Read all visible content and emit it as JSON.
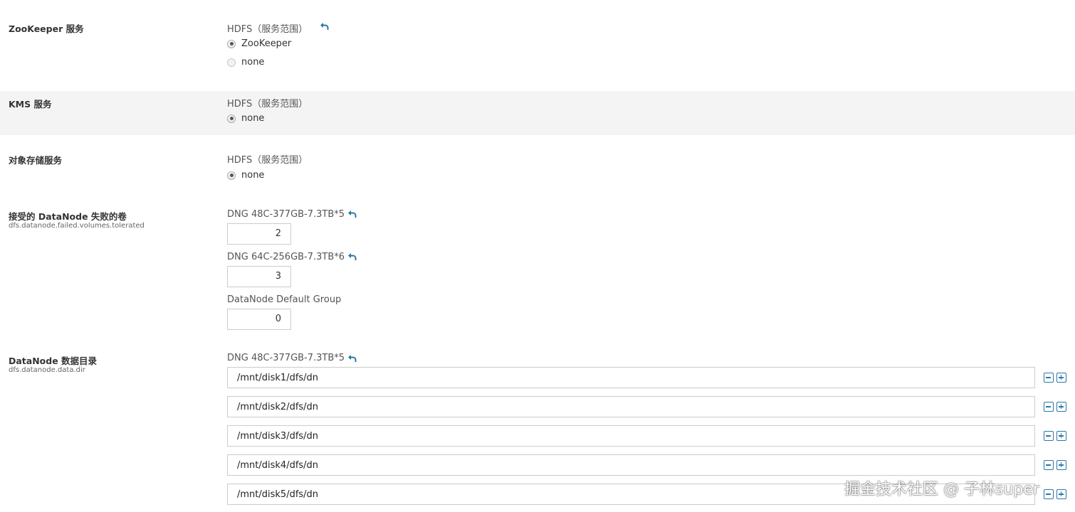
{
  "settings": [
    {
      "label": "ZooKeeper 服务",
      "group": "HDFS（服务范围）",
      "options": [
        "ZooKeeper",
        "none"
      ],
      "selected": "ZooKeeper"
    },
    {
      "label": "KMS 服务",
      "group": "HDFS（服务范围）",
      "options": [
        "none"
      ],
      "selected": "none"
    },
    {
      "label": "对象存储服务",
      "group": "HDFS（服务范围）",
      "options": [
        "none"
      ],
      "selected": "none"
    },
    {
      "label": "接受的 DataNode 失败的卷",
      "property": "dfs.datanode.failed.volumes.tolerated",
      "groups": [
        {
          "name": "DNG 48C-377GB-7.3TB*5",
          "value": "2"
        },
        {
          "name": "DNG 64C-256GB-7.3TB*6",
          "value": "3"
        },
        {
          "name": "DataNode Default Group",
          "value": "0"
        }
      ]
    },
    {
      "label": "DataNode 数据目录",
      "property": "dfs.datanode.data.dir",
      "group": "DNG 48C-377GB-7.3TB*5",
      "dirs": [
        "/mnt/disk1/dfs/dn",
        "/mnt/disk2/dfs/dn",
        "/mnt/disk3/dfs/dn",
        "/mnt/disk4/dfs/dn",
        "/mnt/disk5/dfs/dn"
      ]
    }
  ],
  "icons": {
    "revert": "undo-arrow-icon",
    "remove": "minus-square-icon",
    "add": "plus-square-icon",
    "accent": "#2a77a6"
  },
  "watermark": "掘金技术社区 @ 子林super"
}
